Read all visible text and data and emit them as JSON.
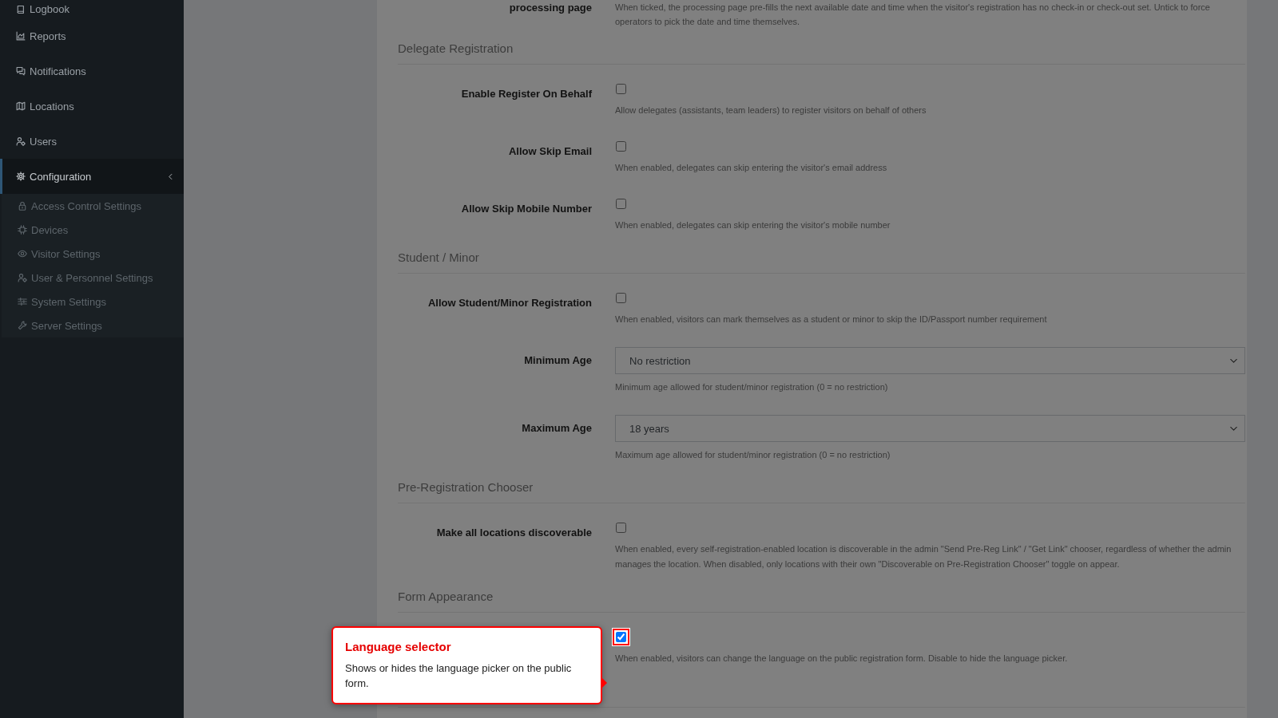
{
  "sidebar": {
    "items": [
      {
        "label": "Logbook",
        "selected": false
      },
      {
        "label": "Reports",
        "selected": false
      },
      {
        "label": "Notifications",
        "selected": false
      },
      {
        "label": "Locations",
        "selected": false
      },
      {
        "label": "Users",
        "selected": false
      },
      {
        "label": "Configuration",
        "selected": true,
        "expanded": true,
        "children": [
          {
            "label": "Access Control Settings",
            "selected": false
          },
          {
            "label": "Devices",
            "selected": false
          },
          {
            "label": "Visitor Settings",
            "selected": false
          },
          {
            "label": "User & Personnel Settings",
            "selected": false
          },
          {
            "label": "System Settings",
            "selected": false
          },
          {
            "label": "Server Settings",
            "selected": false
          }
        ]
      }
    ]
  },
  "form": {
    "top_row": {
      "label": "processing page",
      "description": "When ticked, the processing page pre-fills the next available date and time when the visitor's registration has no check-in or check-out set. Untick to force operators to pick the date and time themselves."
    },
    "sections": [
      {
        "title": "Delegate Registration",
        "rows": [
          {
            "kind": "checkbox",
            "label": "Enable Register On Behalf",
            "checked": false,
            "highlighted": false,
            "description": "Allow delegates (assistants, team leaders) to register visitors on behalf of others"
          },
          {
            "kind": "checkbox",
            "label": "Allow Skip Email",
            "checked": false,
            "highlighted": false,
            "description": "When enabled, delegates can skip entering the visitor's email address"
          },
          {
            "kind": "checkbox",
            "label": "Allow Skip Mobile Number",
            "checked": false,
            "highlighted": false,
            "description": "When enabled, delegates can skip entering the visitor's mobile number"
          }
        ]
      },
      {
        "title": "Student / Minor",
        "rows": [
          {
            "kind": "checkbox",
            "label": "Allow Student/Minor Registration",
            "checked": false,
            "highlighted": false,
            "description": "When enabled, visitors can mark themselves as a student or minor to skip the ID/Passport number requirement"
          },
          {
            "kind": "select",
            "label": "Minimum Age",
            "value": "No restriction",
            "highlighted": false,
            "description": "Minimum age allowed for student/minor registration (0 = no restriction)"
          },
          {
            "kind": "select",
            "label": "Maximum Age",
            "value": "18 years",
            "highlighted": false,
            "description": "Maximum age allowed for student/minor registration (0 = no restriction)"
          }
        ]
      },
      {
        "title": "Pre-Registration Chooser",
        "rows": [
          {
            "kind": "checkbox",
            "label": "Make all locations discoverable",
            "checked": false,
            "highlighted": false,
            "description": "When enabled, every self-registration-enabled location is discoverable in the admin \"Send Pre-Reg Link\" / \"Get Link\" chooser, regardless of whether the admin manages the location. When disabled, only locations with their own \"Discoverable on Pre-Registration Chooser\" toggle on appear."
          }
        ]
      },
      {
        "title": "Form Appearance",
        "rows": [
          {
            "kind": "checkbox",
            "checked": true,
            "highlighted": true,
            "description": "When enabled, visitors can change the language on the public registration form. Disable to hide the language picker."
          }
        ]
      }
    ]
  },
  "tour": {
    "title": "Language selector",
    "text": "Shows or hides the language picker on the public form."
  }
}
